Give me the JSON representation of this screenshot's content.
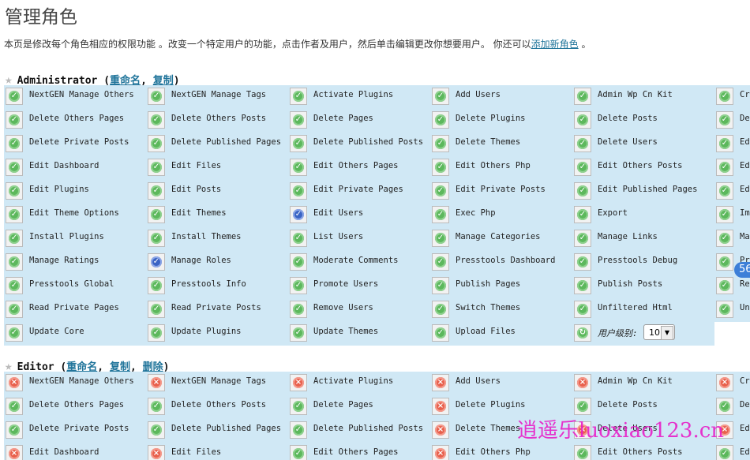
{
  "page": {
    "title": "管理角色",
    "desc_text": "本页是修改每个角色相应的权限功能 。改变一个特定用户的功能，点击作者及用户，然后单击编辑更改你想要用户。 你还可以",
    "add_role_link": "添加新角色",
    "desc_end": " 。"
  },
  "roles": [
    {
      "name": "Administrator",
      "links": [
        "重命名",
        "复制"
      ],
      "caps": [
        [
          "NextGEN Manage Others",
          "g"
        ],
        [
          "NextGEN Manage Tags",
          "g"
        ],
        [
          "Activate Plugins",
          "g"
        ],
        [
          "Add Users",
          "g"
        ],
        [
          "Admin Wp Cn Kit",
          "g"
        ],
        [
          "Cr",
          "g"
        ],
        [
          "Delete Others Pages",
          "g"
        ],
        [
          "Delete Others Posts",
          "g"
        ],
        [
          "Delete Pages",
          "g"
        ],
        [
          "Delete Plugins",
          "g"
        ],
        [
          "Delete Posts",
          "g"
        ],
        [
          "De",
          "g"
        ],
        [
          "Delete Private Posts",
          "g"
        ],
        [
          "Delete Published Pages",
          "g"
        ],
        [
          "Delete Published Posts",
          "g"
        ],
        [
          "Delete Themes",
          "g"
        ],
        [
          "Delete Users",
          "g"
        ],
        [
          "Ed",
          "g"
        ],
        [
          "Edit Dashboard",
          "g"
        ],
        [
          "Edit Files",
          "g"
        ],
        [
          "Edit Others Pages",
          "g"
        ],
        [
          "Edit Others Php",
          "g"
        ],
        [
          "Edit Others Posts",
          "g"
        ],
        [
          "Ed",
          "g"
        ],
        [
          "Edit Plugins",
          "g"
        ],
        [
          "Edit Posts",
          "g"
        ],
        [
          "Edit Private Pages",
          "g"
        ],
        [
          "Edit Private Posts",
          "g"
        ],
        [
          "Edit Published Pages",
          "g"
        ],
        [
          "Ed",
          "g"
        ],
        [
          "Edit Theme Options",
          "g"
        ],
        [
          "Edit Themes",
          "g"
        ],
        [
          "Edit Users",
          "b"
        ],
        [
          "Exec Php",
          "g"
        ],
        [
          "Export",
          "g"
        ],
        [
          "Im",
          "g"
        ],
        [
          "Install Plugins",
          "g"
        ],
        [
          "Install Themes",
          "g"
        ],
        [
          "List Users",
          "g"
        ],
        [
          "Manage Categories",
          "g"
        ],
        [
          "Manage Links",
          "g"
        ],
        [
          "Ma",
          "g"
        ],
        [
          "Manage Ratings",
          "g"
        ],
        [
          "Manage Roles",
          "b"
        ],
        [
          "Moderate Comments",
          "g"
        ],
        [
          "Presstools Dashboard",
          "g"
        ],
        [
          "Presstools Debug",
          "g"
        ],
        [
          "Pr",
          "g"
        ],
        [
          "Presstools Global",
          "g"
        ],
        [
          "Presstools Info",
          "g"
        ],
        [
          "Promote Users",
          "g"
        ],
        [
          "Publish Pages",
          "g"
        ],
        [
          "Publish Posts",
          "g"
        ],
        [
          "Re",
          "g"
        ],
        [
          "Read Private Pages",
          "g"
        ],
        [
          "Read Private Posts",
          "g"
        ],
        [
          "Remove Users",
          "g"
        ],
        [
          "Switch Themes",
          "g"
        ],
        [
          "Unfiltered Html",
          "g"
        ],
        [
          "Un",
          "g"
        ],
        [
          "Update Core",
          "g"
        ],
        [
          "Update Plugins",
          "g"
        ],
        [
          "Update Themes",
          "g"
        ],
        [
          "Upload Files",
          "g"
        ]
      ],
      "level_label": "用户级别:",
      "level_value": "10"
    },
    {
      "name": "Editor",
      "links": [
        "重命名",
        "复制",
        "删除"
      ],
      "caps": [
        [
          "NextGEN Manage Others",
          "r"
        ],
        [
          "NextGEN Manage Tags",
          "r"
        ],
        [
          "Activate Plugins",
          "r"
        ],
        [
          "Add Users",
          "r"
        ],
        [
          "Admin Wp Cn Kit",
          "r"
        ],
        [
          "Cr",
          "r"
        ],
        [
          "Delete Others Pages",
          "g"
        ],
        [
          "Delete Others Posts",
          "g"
        ],
        [
          "Delete Pages",
          "g"
        ],
        [
          "Delete Plugins",
          "r"
        ],
        [
          "Delete Posts",
          "g"
        ],
        [
          "De",
          "g"
        ],
        [
          "Delete Private Posts",
          "g"
        ],
        [
          "Delete Published Pages",
          "g"
        ],
        [
          "Delete Published Posts",
          "g"
        ],
        [
          "Delete Themes",
          "r"
        ],
        [
          "Delete Users",
          "r"
        ],
        [
          "Ed",
          "r"
        ],
        [
          "Edit Dashboard",
          "r"
        ],
        [
          "Edit Files",
          "r"
        ],
        [
          "Edit Others Pages",
          "g"
        ],
        [
          "Edit Others Php",
          "r"
        ],
        [
          "Edit Others Posts",
          "g"
        ],
        [
          "Ed",
          "g"
        ]
      ]
    }
  ],
  "overlay": {
    "watermark": "逍遥乐luoxiao123.cn",
    "badge": "56"
  },
  "colors": {
    "grid_bg": "#d0e8f5",
    "link": "#21759b",
    "granted": "#5cb85c",
    "denied": "#e8604c",
    "locked": "#3a63c4"
  }
}
